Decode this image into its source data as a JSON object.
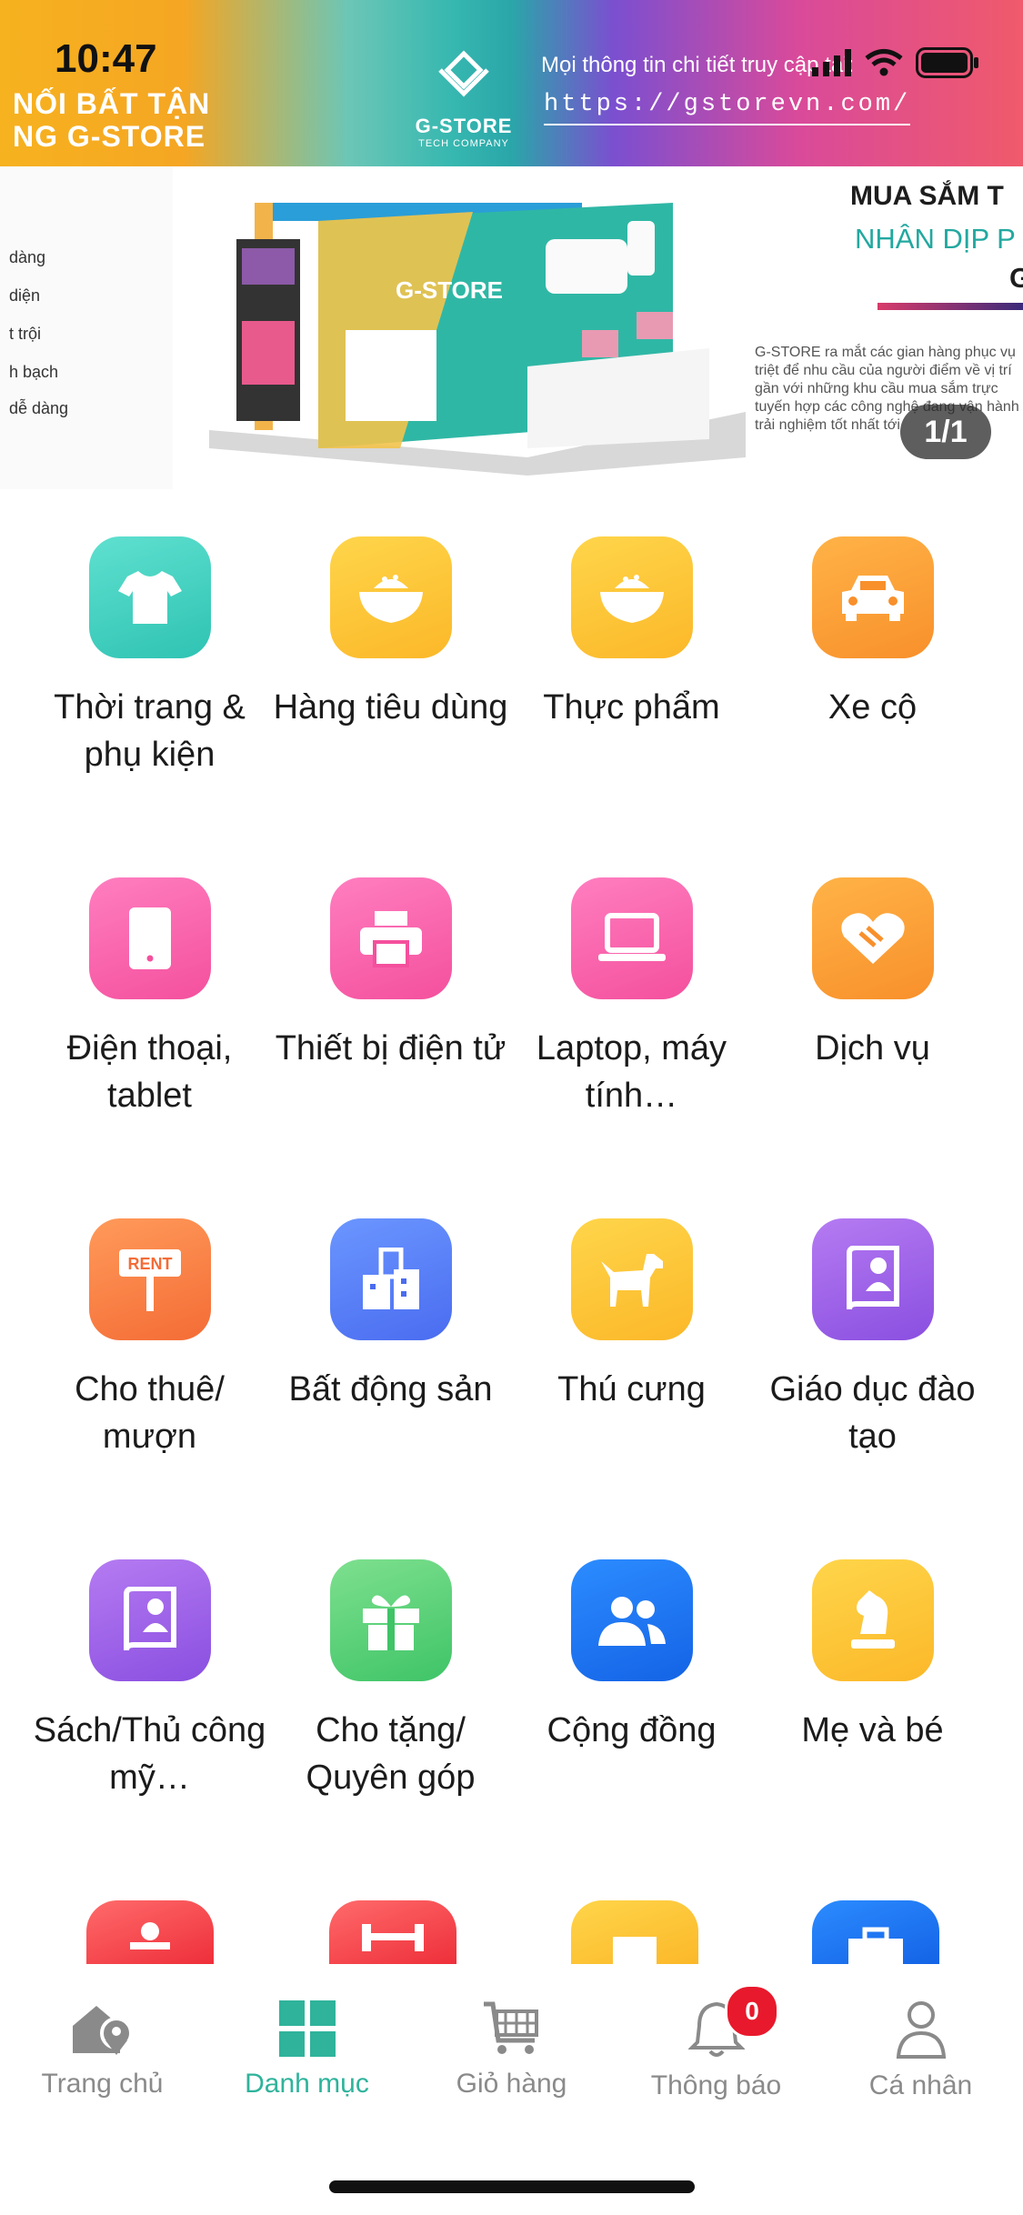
{
  "status_bar": {
    "time": "10:47"
  },
  "banner": {
    "left_line1": "NỐI BẤT TẬN",
    "left_line2": "NG G-STORE",
    "brand": "G-STORE",
    "brand_sub": "TECH COMPANY",
    "info": "Mọi thông tin chi tiết truy cập tại:",
    "url": "https://gstorevn.com/"
  },
  "carousel": {
    "pager": "1/1",
    "left_lines": [
      "dàng",
      "diện",
      "t trội",
      "h bạch",
      "dễ dàng"
    ],
    "right_title": "MUA SẮM T",
    "right_subtitle": "NHÂN DỊP P",
    "right_letter": "G",
    "right_paragraph": "G-STORE ra mắt các gian hàng phục vụ triệt để nhu cầu của người điểm về vị trí gần với những khu cầu mua sắm trực tuyến hợp các công nghệ đang vận hành trải nghiệm tốt nhất tới",
    "booth_brand": "G-STORE"
  },
  "categories": [
    {
      "label": "Thời trang & phụ kiện",
      "icon": "shirt-icon",
      "color_a": "#5fe0cf",
      "color_b": "#2fc3b3"
    },
    {
      "label": "Hàng tiêu dùng",
      "icon": "bowl-icon",
      "color_a": "#ffd54a",
      "color_b": "#fbb829"
    },
    {
      "label": "Thực phẩm",
      "icon": "bowl-icon",
      "color_a": "#ffd54a",
      "color_b": "#fbb829"
    },
    {
      "label": "Xe cộ",
      "icon": "car-icon",
      "color_a": "#ffb347",
      "color_b": "#f8902b"
    },
    {
      "label": "Điện thoại, tablet",
      "icon": "phone-icon",
      "color_a": "#ff7ec0",
      "color_b": "#f4509d"
    },
    {
      "label": "Thiết bị điện tử",
      "icon": "printer-icon",
      "color_a": "#ff7ec0",
      "color_b": "#f4509d"
    },
    {
      "label": "Laptop, máy tính…",
      "icon": "laptop-icon",
      "color_a": "#ff7ec0",
      "color_b": "#f4509d"
    },
    {
      "label": "Dịch vụ",
      "icon": "handshake-icon",
      "color_a": "#ffb347",
      "color_b": "#f8902b"
    },
    {
      "label": "Cho thuê/ mượn",
      "icon": "rent-sign-icon",
      "color_a": "#ff9a5a",
      "color_b": "#f46c36"
    },
    {
      "label": "Bất động sản",
      "icon": "building-icon",
      "color_a": "#6b96ff",
      "color_b": "#4a6cf0"
    },
    {
      "label": "Thú cưng",
      "icon": "dog-icon",
      "color_a": "#ffd54a",
      "color_b": "#fbb829"
    },
    {
      "label": "Giáo dục đào tạo",
      "icon": "education-book-icon",
      "color_a": "#b57bf2",
      "color_b": "#8a4fe0"
    },
    {
      "label": "Sách/Thủ công mỹ…",
      "icon": "book-icon",
      "color_a": "#b57bf2",
      "color_b": "#8a4fe0"
    },
    {
      "label": "Cho tặng/ Quyên góp",
      "icon": "gift-icon",
      "color_a": "#7ee08f",
      "color_b": "#3fc467"
    },
    {
      "label": "Cộng đồng",
      "icon": "users-icon",
      "color_a": "#2c8cff",
      "color_b": "#1463e6"
    },
    {
      "label": "Mẹ và bé",
      "icon": "chess-knight-icon",
      "color_a": "#ffd54a",
      "color_b": "#fbb829"
    }
  ],
  "nav": {
    "items": [
      {
        "label": "Trang chủ",
        "icon": "home-map-icon"
      },
      {
        "label": "Danh mục",
        "icon": "grid-icon"
      },
      {
        "label": "Giỏ hàng",
        "icon": "cart-icon"
      },
      {
        "label": "Thông báo",
        "icon": "bell-icon"
      },
      {
        "label": "Cá nhân",
        "icon": "user-icon"
      }
    ],
    "notification_count": "0",
    "active_color": "#2fb39b",
    "inactive_color": "#8a8a8a"
  }
}
